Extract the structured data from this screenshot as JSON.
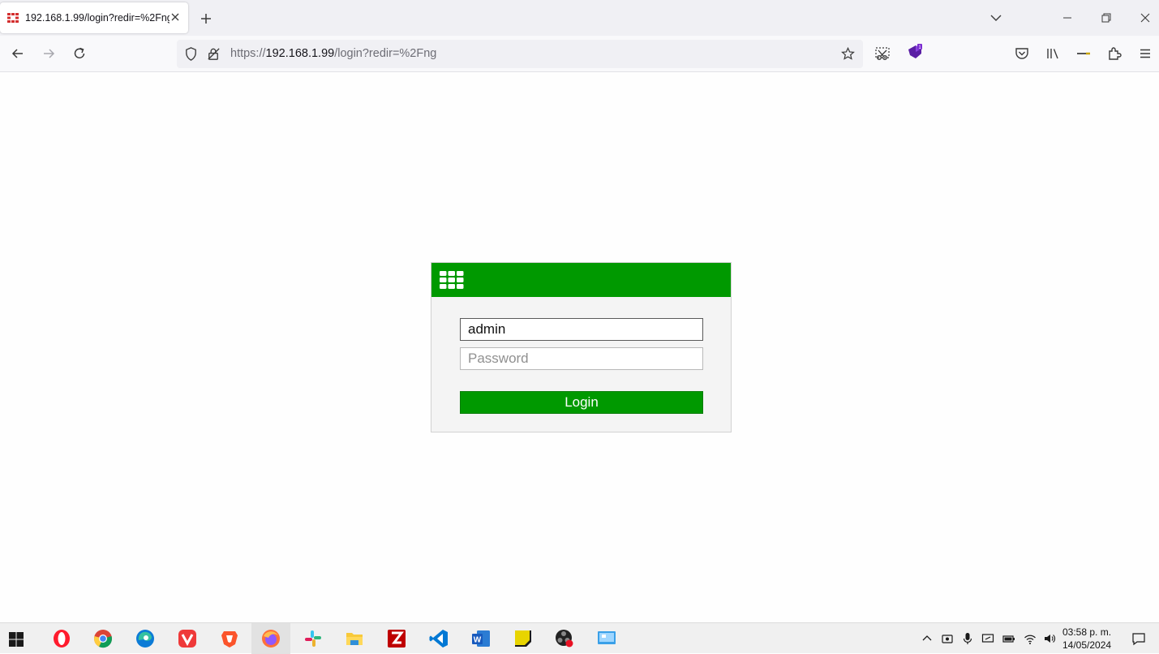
{
  "browser": {
    "tab": {
      "title": "192.168.1.99/login?redir=%2Fng"
    },
    "url": {
      "scheme": "https://",
      "host": "192.168.1.99",
      "path": "/login?redir=%2Fng"
    },
    "accent": "#009900"
  },
  "login": {
    "username_value": "admin",
    "password_placeholder": "Password",
    "login_label": "Login"
  },
  "taskbar": {
    "apps": [
      "opera-icon",
      "chrome-icon",
      "edge-icon",
      "vivaldi-icon",
      "brave-icon",
      "firefox-icon",
      "slack-icon",
      "file-explorer-icon",
      "filezilla-icon",
      "vscode-icon",
      "word-icon",
      "sticky-notes-icon",
      "obs-icon",
      "remote-desktop-icon"
    ],
    "clock": {
      "time": "03:58 p. m.",
      "date": "14/05/2024"
    }
  }
}
